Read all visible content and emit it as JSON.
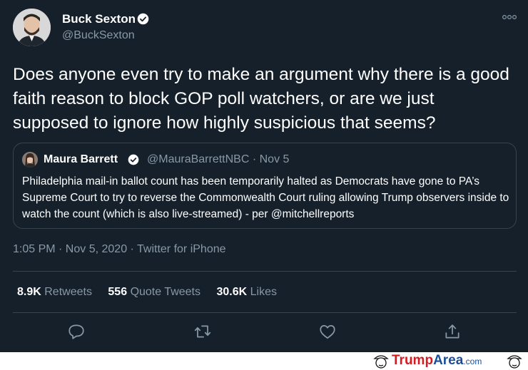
{
  "tweet": {
    "author": {
      "name": "Buck Sexton",
      "handle": "@BuckSexton"
    },
    "text": "Does anyone even try to make an argument why there is a good faith reason to block GOP poll watchers, or are we just supposed to ignore how highly suspicious that seems?",
    "quoted": {
      "name": "Maura Barrett",
      "handle_date": "@MauraBarrettNBC · Nov 5",
      "text": "Philadelphia mail-in ballot count has been temporarily halted as Democrats have gone to PA’s Supreme Court to try to reverse the Commonwealth Court ruling allowing Trump observers inside to watch the count (which is also live-streamed) - per @mitchellreports"
    },
    "meta": "1:05 PM · Nov 5, 2020 · Twitter for iPhone",
    "stats": {
      "retweets_count": "8.9K",
      "retweets_label": "Retweets",
      "quotes_count": "556",
      "quotes_label": "Quote Tweets",
      "likes_count": "30.6K",
      "likes_label": "Likes"
    },
    "actions": [
      "reply-icon",
      "retweet-icon",
      "like-icon",
      "share-icon"
    ],
    "colors": {
      "background": "#15202b",
      "secondary_text": "#8899a6",
      "border": "#38444d",
      "verified": "#ffffff"
    }
  },
  "footer": {
    "logo_trump": "Trump",
    "logo_area": "Area",
    "logo_com": ".com",
    "colors": {
      "trump": "#d71920",
      "area": "#1b4f9c"
    }
  }
}
